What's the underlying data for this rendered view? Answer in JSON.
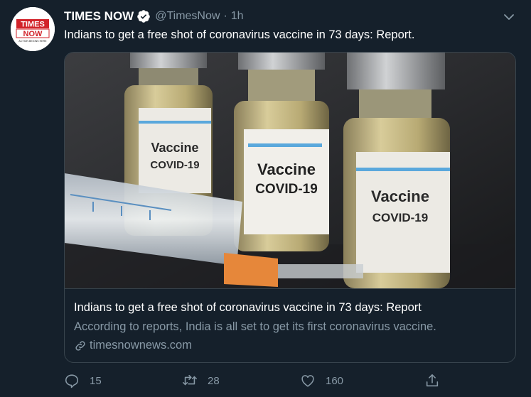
{
  "tweet": {
    "author": {
      "display_name": "TIMES NOW",
      "handle": "@TimesNow",
      "verified_icon": "verified-badge-icon",
      "avatar": {
        "logo_line1": "TIMES",
        "logo_line2": "NOW",
        "tagline": "ACTION BEGINS HERE",
        "brand_color": "#d2232a"
      }
    },
    "separator": "·",
    "time": "1h",
    "text": "Indians to get a free shot of coronavirus vaccine in 73 days: Report.",
    "card": {
      "image_labels": {
        "vial_line1": "Vaccine",
        "vial_line2": "COVID-19"
      },
      "title": "Indians to get a free shot of coronavirus vaccine in 73 days: Report",
      "description": "According to reports, India is all set to get its first coronavirus vaccine.",
      "domain": "timesnownews.com"
    },
    "actions": {
      "replies": "15",
      "retweets": "28",
      "likes": "160"
    }
  },
  "colors": {
    "background": "#15202b",
    "border": "#38444d",
    "secondary_text": "#8899a6",
    "verified": "#ffffff"
  }
}
